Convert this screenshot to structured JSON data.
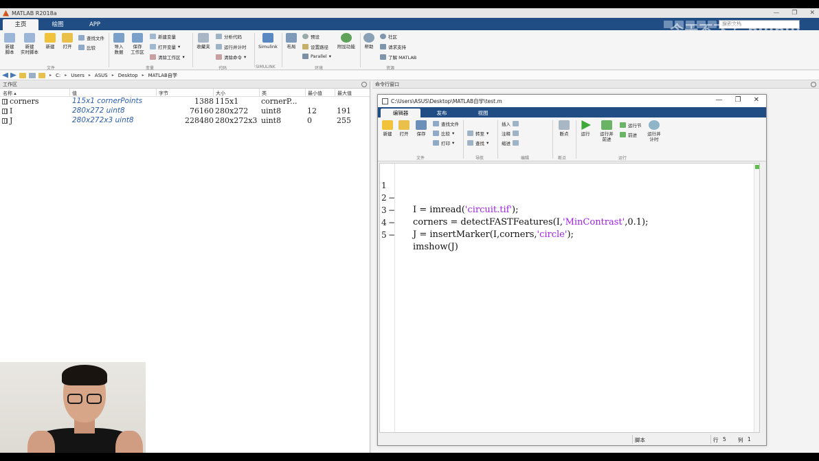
{
  "app": {
    "title": "MATLAB R2018a"
  },
  "window_controls": [
    "—",
    "❐",
    "✕"
  ],
  "ribbon_tabs": [
    {
      "label": "主页",
      "active": true
    },
    {
      "label": "绘图",
      "active": false
    },
    {
      "label": "APP",
      "active": false
    }
  ],
  "search": {
    "placeholder": "搜索文档"
  },
  "watermark": "今天不飞了 bilibili",
  "ribbon": {
    "file": {
      "new_script": "新建\n脚本",
      "new_live_script": "新建\n实时脚本",
      "new": "新建",
      "open": "打开",
      "find_files": "查找文件",
      "compare": "比较",
      "group": "文件"
    },
    "variable": {
      "import": "导入\n数据",
      "save_ws": "保存\n工作区",
      "new_var": "新建变量",
      "open_var": "打开变量",
      "clear_ws": "清除工作区",
      "group": "变量"
    },
    "code": {
      "favorites": "收藏夹",
      "analyze": "分析代码",
      "run_time": "运行并计时",
      "clear_cmds": "清除命令",
      "group": "代码"
    },
    "simulink": {
      "label": "Simulink",
      "group": "SIMULINK"
    },
    "env": {
      "layout": "布局",
      "prefs": "预设",
      "set_path": "设置路径",
      "parallel": "Parallel",
      "addons": "附加功能",
      "group": "环境"
    },
    "resources": {
      "help": "帮助",
      "community": "社区",
      "request_support": "请求支持",
      "learn": "了解 MATLAB",
      "group": "资源"
    }
  },
  "address": {
    "path": [
      "C:",
      "Users",
      "ASUS",
      "Desktop",
      "MATLAB自学"
    ]
  },
  "workspace": {
    "title": "工作区",
    "columns": {
      "name": "名称 ▴",
      "value": "值",
      "bytes": "字节",
      "size": "大小",
      "class": "类",
      "min": "最小值",
      "max": "最大值"
    },
    "rows": [
      {
        "name": "corners",
        "value": "115x1 cornerPoints",
        "bytes": "1388",
        "size": "115x1",
        "class": "cornerP...",
        "min": "",
        "max": ""
      },
      {
        "name": "I",
        "value": "280x272 uint8",
        "bytes": "76160",
        "size": "280x272",
        "class": "uint8",
        "min": "12",
        "max": "191"
      },
      {
        "name": "J",
        "value": "280x272x3 uint8",
        "bytes": "228480",
        "size": "280x272x3",
        "class": "uint8",
        "min": "0",
        "max": "255"
      }
    ]
  },
  "command_window": {
    "title": "命令行窗口"
  },
  "editor": {
    "title": "C:\\Users\\ASUS\\Desktop\\MATLAB自学\\test.m",
    "tabs": [
      {
        "label": "编辑器",
        "active": true
      },
      {
        "label": "发布",
        "active": false
      },
      {
        "label": "视图",
        "active": false
      }
    ],
    "ribbon": {
      "new": "新建",
      "open": "打开",
      "save": "保存",
      "find_files": "查找文件",
      "compare": "比较",
      "print": "打印",
      "insert": "插入",
      "comment": "注释",
      "indent": "缩进",
      "goto": "转至",
      "find": "查找",
      "breakpoints": "断点",
      "run": "运行",
      "run_advance": "运行并\n前进",
      "run_section": "运行节",
      "advance": "前进",
      "run_time": "运行并\n计时",
      "groups": {
        "file": "文件",
        "nav": "导航",
        "edit": "编辑",
        "bp": "断点",
        "run": "运行"
      }
    },
    "lines": [
      {
        "num": "1",
        "dash": "−",
        "pre": "I = imread(",
        "str": "'circuit.tif'",
        "post": ");"
      },
      {
        "num": "2",
        "dash": "−",
        "pre": "corners = detectFASTFeatures(I,",
        "str": "'MinContrast'",
        "post": ",0.1);"
      },
      {
        "num": "3",
        "dash": "−",
        "pre": "J = insertMarker(I,corners,",
        "str": "'circle'",
        "post": ");"
      },
      {
        "num": "4",
        "dash": "−",
        "pre": "imshow(J)",
        "str": "",
        "post": ""
      },
      {
        "num": "5",
        "dash": "",
        "pre": "",
        "str": "",
        "post": ""
      }
    ],
    "status": {
      "type": "脚本",
      "row_label": "行",
      "row": "5",
      "col_label": "列",
      "col": "1"
    }
  },
  "colors": {
    "ribbon_blue": "#1f4d84",
    "string_purple": "#a020f0",
    "value_blue": "#2a5db0"
  }
}
